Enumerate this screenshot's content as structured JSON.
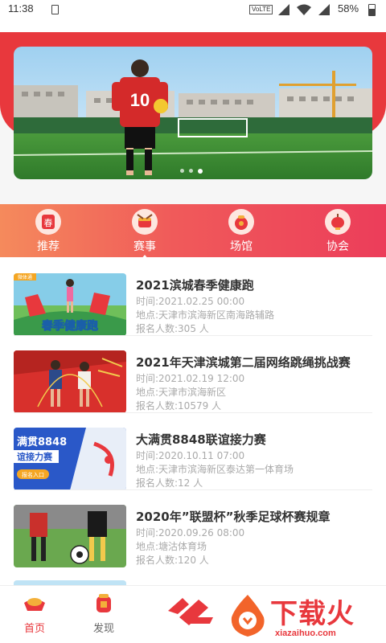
{
  "status_bar": {
    "time": "11:38",
    "network_badge": "VoLTE",
    "battery": "58%"
  },
  "banner": {
    "jersey_number": "10",
    "slide_count": 3,
    "active_slide": 3
  },
  "categories": [
    {
      "label": "推荐",
      "icon": "spring-envelope-icon",
      "active": false
    },
    {
      "label": "赛事",
      "icon": "drum-icon",
      "active": true
    },
    {
      "label": "场馆",
      "icon": "gift-bag-icon",
      "active": false
    },
    {
      "label": "协会",
      "icon": "lantern-icon",
      "active": false
    }
  ],
  "events": [
    {
      "title": "2021滨城春季健康跑",
      "time": "时间:2021.02.25 00:00",
      "location": "地点:天津市滨海新区南海路辅路",
      "signups": "报名人数:305 人",
      "thumb_tag": "微体通",
      "thumb_text": "春季健康跑"
    },
    {
      "title": "2021年天津滨城第二届网络跳绳挑战赛",
      "time": "时间:2021.02.19 12:00",
      "location": "地点:天津市滨海新区",
      "signups": "报名人数:10579 人",
      "thumb_tag": "",
      "thumb_text": ""
    },
    {
      "title": "大满贯8848联谊接力赛",
      "time": "时间:2020.10.11 07:00",
      "location": "地点:天津市滨海新区泰达第一体育场",
      "signups": "报名人数:12 人",
      "thumb_tag": "",
      "thumb_text": "满贯8848",
      "thumb_text2": "谊接力赛",
      "thumb_text3": "报名入口"
    },
    {
      "title": "2020年”联盟杯”秋季足球杯赛规章",
      "time": "时间:2020.09.26 08:00",
      "location": "地点:塘沽体育场",
      "signups": "报名人数:120 人",
      "thumb_tag": "",
      "thumb_text": ""
    }
  ],
  "tabbar": {
    "tabs": [
      {
        "label": "首页",
        "icon": "gold-ingot-icon",
        "active": true
      },
      {
        "label": "发现",
        "icon": "treasure-jar-icon",
        "active": false
      }
    ]
  },
  "watermark": {
    "brand": "下载火",
    "url": "xiazaihuo.com"
  },
  "colors": {
    "primary_red": "#e8383d",
    "nav_gradient_start": "#f58a5c",
    "nav_gradient_end": "#ec3d5a"
  }
}
